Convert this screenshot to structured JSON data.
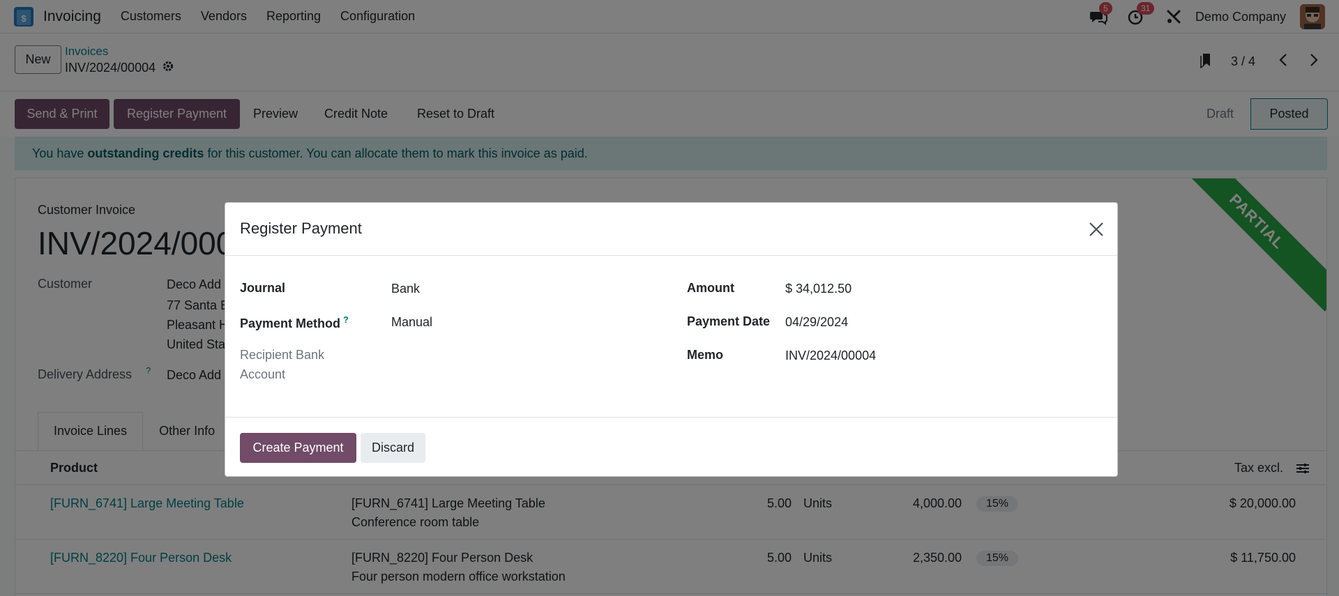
{
  "navbar": {
    "app_name": "Invoicing",
    "menu": [
      "Customers",
      "Vendors",
      "Reporting",
      "Configuration"
    ],
    "messages_count": "5",
    "activities_count": "31",
    "company": "Demo Company",
    "app_icon_glyph": "$"
  },
  "control": {
    "new_label": "New",
    "breadcrumb_parent": "Invoices",
    "breadcrumb_current": "INV/2024/00004",
    "pager": "3 / 4"
  },
  "actions": {
    "send_print": "Send & Print",
    "register_payment": "Register Payment",
    "preview": "Preview",
    "credit_note": "Credit Note",
    "reset_draft": "Reset to Draft",
    "status_draft": "Draft",
    "status_posted": "Posted"
  },
  "alert": {
    "prefix": "You have ",
    "bold": "outstanding credits",
    "suffix": " for this customer. You can allocate them to mark this invoice as paid."
  },
  "sheet": {
    "ribbon": "PARTIAL",
    "doc_type": "Customer Invoice",
    "doc_name": "INV/2024/000",
    "customer_label": "Customer",
    "customer_name": "Deco Add",
    "addr_line1": "77 Santa B",
    "addr_line2": "Pleasant H",
    "addr_line3": "United Sta",
    "delivery_label": "Delivery Address",
    "delivery_value": "Deco Add",
    "tabs": [
      "Invoice Lines",
      "Other Info"
    ],
    "col_product": "Product",
    "col_tax_excl": "Tax excl.",
    "lines": [
      {
        "product": "[FURN_6741] Large Meeting Table",
        "label1": "[FURN_6741] Large Meeting Table",
        "label2": "Conference room table",
        "qty": "5.00",
        "uom": "Units",
        "price": "4,000.00",
        "tax": "15%",
        "subtotal": "$ 20,000.00"
      },
      {
        "product": "[FURN_8220] Four Person Desk",
        "label1": "[FURN_8220] Four Person Desk",
        "label2": "Four person modern office workstation",
        "qty": "5.00",
        "uom": "Units",
        "price": "2,350.00",
        "tax": "15%",
        "subtotal": "$ 11,750.00"
      }
    ]
  },
  "modal": {
    "title": "Register Payment",
    "journal_label": "Journal",
    "journal_value": "Bank",
    "method_label": "Payment Method",
    "method_help": "?",
    "method_value": "Manual",
    "recipient_label_1": "Recipient Bank",
    "recipient_label_2": "Account",
    "amount_label": "Amount",
    "amount_value": "$ 34,012.50",
    "date_label": "Payment Date",
    "date_value": "04/29/2024",
    "memo_label": "Memo",
    "memo_value": "INV/2024/00004",
    "create_label": "Create Payment",
    "discard_label": "Discard"
  },
  "colors": {
    "primary": "#714b67",
    "teal": "#017e84",
    "ribbon": "#28a745",
    "badge": "#d44c59"
  }
}
